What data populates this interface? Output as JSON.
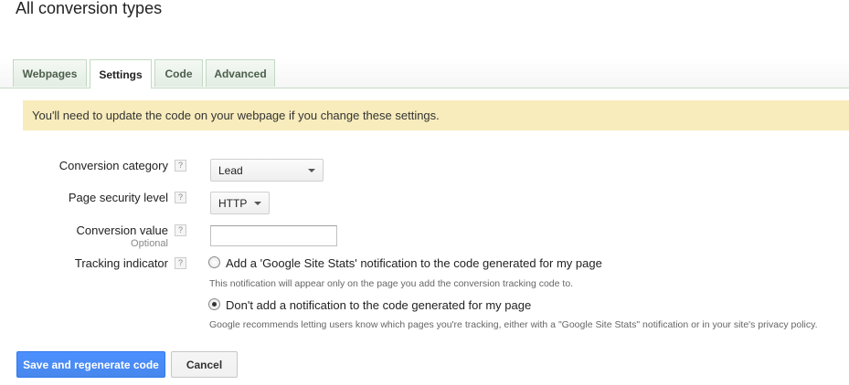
{
  "page": {
    "title": "All conversion types"
  },
  "tabs": [
    {
      "label": "Webpages",
      "active": false
    },
    {
      "label": "Settings",
      "active": true
    },
    {
      "label": "Code",
      "active": false
    },
    {
      "label": "Advanced",
      "active": false
    }
  ],
  "notice": {
    "text": "You'll need to update the code on your webpage if you change these settings."
  },
  "form": {
    "help_glyph": "?",
    "category": {
      "label": "Conversion category",
      "value": "Lead"
    },
    "security": {
      "label": "Page security level",
      "value": "HTTP"
    },
    "value": {
      "label": "Conversion value",
      "sublabel": "Optional",
      "input_value": ""
    },
    "tracking": {
      "label": "Tracking indicator",
      "options": [
        {
          "label": "Add a 'Google Site Stats' notification to the code generated for my page",
          "note": "This notification will appear only on the page you add the conversion tracking code to.",
          "checked": false
        },
        {
          "label": "Don't add a notification to the code generated for my page",
          "note": "Google recommends letting users know which pages you're tracking, either with a \"Google Site Stats\" notification or in your site's privacy policy.",
          "checked": true
        }
      ]
    }
  },
  "buttons": {
    "save": "Save and regenerate code",
    "cancel": "Cancel"
  }
}
